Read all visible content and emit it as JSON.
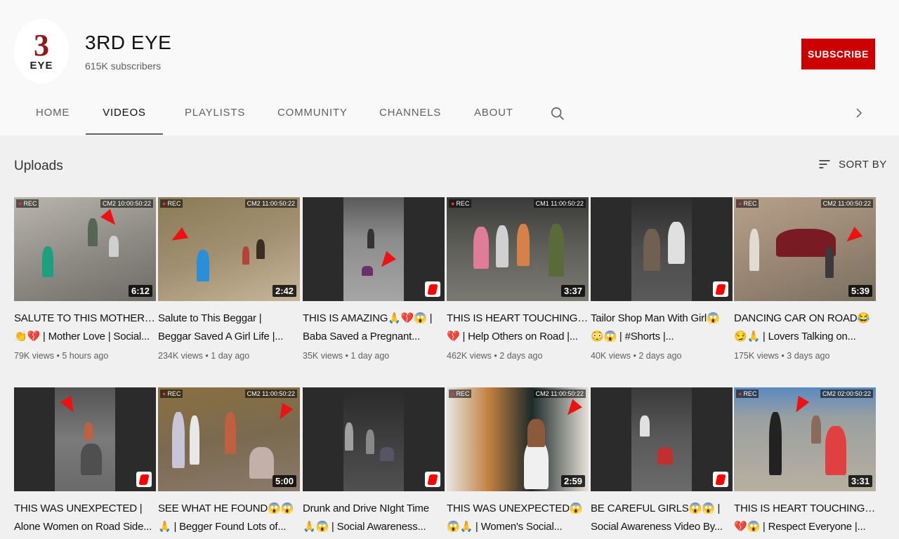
{
  "channel": {
    "logo_number": "3",
    "logo_text": "EYE",
    "title": "3RD EYE",
    "subscribers": "615K subscribers",
    "subscribe_label": "SUBSCRIBE"
  },
  "tabs": [
    {
      "label": "HOME"
    },
    {
      "label": "VIDEOS"
    },
    {
      "label": "PLAYLISTS"
    },
    {
      "label": "COMMUNITY"
    },
    {
      "label": "CHANNELS"
    },
    {
      "label": "ABOUT"
    }
  ],
  "active_tab": "VIDEOS",
  "section": {
    "title": "Uploads",
    "sort_label": "SORT BY"
  },
  "colors": {
    "accent": "#cc0000",
    "background": "#f9f9f9",
    "content_bg": "#f0f0f0"
  },
  "icons": {
    "search": "search-icon",
    "next": "chevron-right-icon",
    "sort": "sort-icon",
    "shorts": "shorts-icon"
  },
  "videos": [
    {
      "line1": "SALUTE TO THIS MOTHER🙏",
      "line2": "👏💔 | Mother Love | Social...",
      "views": "79K views",
      "age": "5 hours ago",
      "duration": "6:12",
      "rec": "REC",
      "cam": "CM2 10:00:50:22"
    },
    {
      "line1": "Salute to This Beggar |",
      "line2": "Beggar Saved A Girl Life |...",
      "views": "234K views",
      "age": "1 day ago",
      "duration": "2:42",
      "rec": "REC",
      "cam": "CM2 11:00:50:22"
    },
    {
      "line1": "THIS IS AMAZING🙏💔😱 |",
      "line2": "Baba Saved a Pregnant...",
      "views": "35K views",
      "age": "1 day ago",
      "duration": "",
      "rec": "",
      "cam": ""
    },
    {
      "line1": "THIS IS HEART TOUCHING🙏",
      "line2": "💔 | Help Others on Road |...",
      "views": "462K views",
      "age": "2 days ago",
      "duration": "3:37",
      "rec": "REC",
      "cam": "CM1 11:00:50:22"
    },
    {
      "line1": "Tailor Shop Man With Girl😱",
      "line2": "😳😱 | #Shorts |...",
      "views": "40K views",
      "age": "2 days ago",
      "duration": "",
      "rec": "",
      "cam": ""
    },
    {
      "line1": "DANCING CAR ON ROAD😂",
      "line2": "😏🙏 | Lovers Talking on...",
      "views": "175K views",
      "age": "3 days ago",
      "duration": "5:39",
      "rec": "REC",
      "cam": "CM2 11:00:50:22"
    },
    {
      "line1": "THIS WAS UNEXPECTED |",
      "line2": "Alone Women on Road Side...",
      "views": "",
      "age": "",
      "duration": "",
      "rec": "",
      "cam": ""
    },
    {
      "line1": "SEE WHAT HE FOUND😱😱",
      "line2": "🙏 | Begger Found Lots of...",
      "views": "",
      "age": "",
      "duration": "5:00",
      "rec": "REC",
      "cam": "CM2 11:00:50:22"
    },
    {
      "line1": "Drunk and Drive NIght Time",
      "line2": "🙏😱 | Social Awareness...",
      "views": "",
      "age": "",
      "duration": "",
      "rec": "",
      "cam": ""
    },
    {
      "line1": "THIS WAS UNEXPECTED😱",
      "line2": "😱🙏 | Women's Social...",
      "views": "",
      "age": "",
      "duration": "2:59",
      "rec": "REC",
      "cam": "CM2 11:00:50:22"
    },
    {
      "line1": "BE CAREFUL GIRLS😱😱 |",
      "line2": "Social Awareness Video By...",
      "views": "",
      "age": "",
      "duration": "",
      "rec": "",
      "cam": ""
    },
    {
      "line1": "THIS IS HEART TOUCHING🙏",
      "line2": "💔😱 | Respect Everyone |...",
      "views": "",
      "age": "",
      "duration": "3:31",
      "rec": "REC",
      "cam": "CM2 02:00:50:22"
    }
  ]
}
